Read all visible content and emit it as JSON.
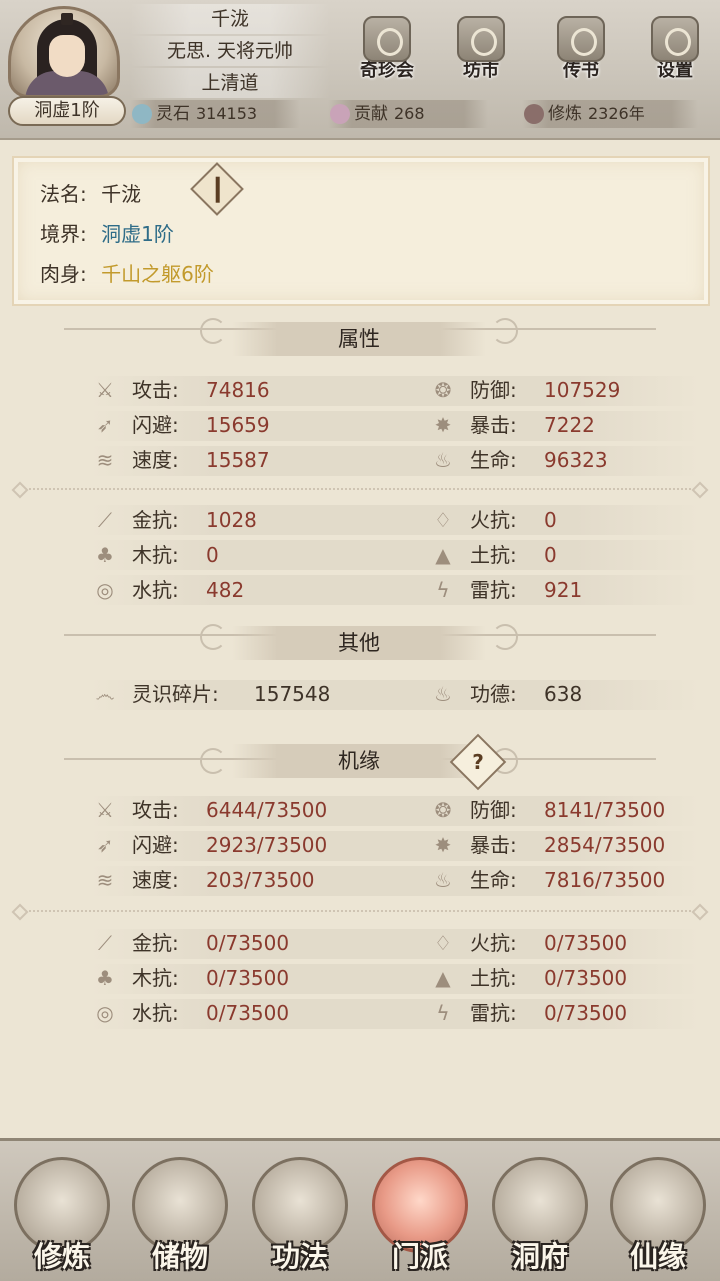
{
  "header": {
    "name": "千泷",
    "title": "无思. 天将元帅",
    "sect": "上清道",
    "realm_badge": "洞虚1阶",
    "buttons": [
      {
        "label": "奇珍会",
        "icon": "treasure-pavilion-icon"
      },
      {
        "label": "坊市",
        "icon": "market-icon"
      },
      {
        "label": "传书",
        "icon": "scroll-letter-icon"
      },
      {
        "label": "设置",
        "icon": "gear-icon"
      }
    ],
    "resources": [
      {
        "label": "灵石",
        "value": "314153",
        "icon": "spirit-stone-icon",
        "color": "#8fb7c4"
      },
      {
        "label": "贡献",
        "value": "268",
        "icon": "contribution-icon",
        "color": "#c9a3b8"
      },
      {
        "label": "修炼",
        "value": "2326年",
        "icon": "cultivation-icon",
        "color": "#8a6e6a"
      }
    ]
  },
  "profile": {
    "dharma_name_label": "法名:",
    "dharma_name": "千泷",
    "realm_label": "境界:",
    "realm": "洞虚1阶",
    "body_label": "肉身:",
    "body": "千山之躯6阶",
    "colors": {
      "realm": "#2e6c88",
      "body": "#c29a2c"
    }
  },
  "attributes": {
    "title": "属性",
    "main": [
      {
        "label": "攻击:",
        "value": "74816",
        "icon": "attack-icon"
      },
      {
        "label": "防御:",
        "value": "107529",
        "icon": "defense-icon"
      },
      {
        "label": "闪避:",
        "value": "15659",
        "icon": "dodge-icon"
      },
      {
        "label": "暴击:",
        "value": "7222",
        "icon": "critical-icon"
      },
      {
        "label": "速度:",
        "value": "15587",
        "icon": "speed-icon"
      },
      {
        "label": "生命:",
        "value": "96323",
        "icon": "life-icon"
      }
    ],
    "resist": [
      {
        "label": "金抗:",
        "value": "1028",
        "icon": "metal-icon"
      },
      {
        "label": "火抗:",
        "value": "0",
        "icon": "fire-icon"
      },
      {
        "label": "木抗:",
        "value": "0",
        "icon": "wood-icon"
      },
      {
        "label": "土抗:",
        "value": "0",
        "icon": "earth-icon"
      },
      {
        "label": "水抗:",
        "value": "482",
        "icon": "water-icon"
      },
      {
        "label": "雷抗:",
        "value": "921",
        "icon": "thunder-icon"
      }
    ]
  },
  "others": {
    "title": "其他",
    "items": [
      {
        "label": "灵识碎片:",
        "value": "157548",
        "icon": "soul-shard-icon"
      },
      {
        "label": "功德:",
        "value": "638",
        "icon": "merit-icon"
      }
    ]
  },
  "fortune": {
    "title": "机缘",
    "help": "?",
    "main": [
      {
        "label": "攻击:",
        "value": "6444/73500",
        "icon": "attack-icon"
      },
      {
        "label": "防御:",
        "value": "8141/73500",
        "icon": "defense-icon"
      },
      {
        "label": "闪避:",
        "value": "2923/73500",
        "icon": "dodge-icon"
      },
      {
        "label": "暴击:",
        "value": "2854/73500",
        "icon": "critical-icon"
      },
      {
        "label": "速度:",
        "value": "203/73500",
        "icon": "speed-icon"
      },
      {
        "label": "生命:",
        "value": "7816/73500",
        "icon": "life-icon"
      }
    ],
    "resist": [
      {
        "label": "金抗:",
        "value": "0/73500",
        "icon": "metal-icon"
      },
      {
        "label": "火抗:",
        "value": "0/73500",
        "icon": "fire-icon"
      },
      {
        "label": "木抗:",
        "value": "0/73500",
        "icon": "wood-icon"
      },
      {
        "label": "土抗:",
        "value": "0/73500",
        "icon": "earth-icon"
      },
      {
        "label": "水抗:",
        "value": "0/73500",
        "icon": "water-icon"
      },
      {
        "label": "雷抗:",
        "value": "0/73500",
        "icon": "thunder-icon"
      }
    ]
  },
  "nav": [
    {
      "label": "修炼",
      "icon": "cultivate-icon",
      "active": false
    },
    {
      "label": "储物",
      "icon": "storage-bag-icon",
      "active": false
    },
    {
      "label": "功法",
      "icon": "technique-scroll-icon",
      "active": false
    },
    {
      "label": "门派",
      "icon": "sect-gate-icon",
      "active": true
    },
    {
      "label": "洞府",
      "icon": "cave-dwelling-icon",
      "active": false
    },
    {
      "label": "仙缘",
      "icon": "immortal-fate-icon",
      "active": false
    }
  ]
}
